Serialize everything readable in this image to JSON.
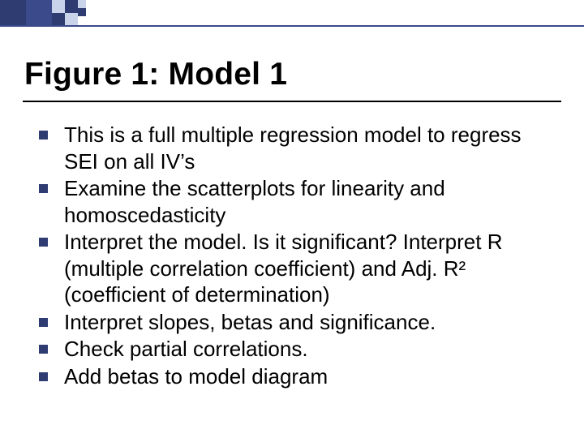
{
  "title": "Figure 1:  Model 1",
  "bullets": [
    "This is a full multiple regression model to regress SEI on all IV’s",
    "Examine the scatterplots for linearity and homoscedasticity",
    "Interpret the model. Is it significant? Interpret R (multiple correlation coefficient) and Adj. R² (coefficient of determination)",
    "Interpret slopes, betas and significance.",
    "Check partial correlations.",
    "Add betas to model diagram"
  ]
}
